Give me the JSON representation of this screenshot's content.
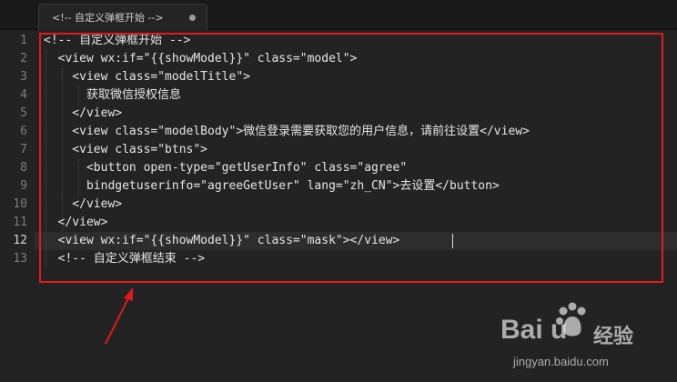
{
  "tab": {
    "title": "<!-- 自定义弹框开始 -->"
  },
  "editor": {
    "active_line": 12,
    "lines": [
      {
        "num": "1",
        "text": "<!-- 自定义弹框开始 -->"
      },
      {
        "num": "2",
        "text": "  <view wx:if=\"{{showModel}}\" class=\"model\">"
      },
      {
        "num": "3",
        "text": "    <view class=\"modelTitle\">"
      },
      {
        "num": "4",
        "text": "      获取微信授权信息"
      },
      {
        "num": "5",
        "text": "    </view>"
      },
      {
        "num": "6",
        "text": "    <view class=\"modelBody\">微信登录需要获取您的用户信息，请前往设置</view>"
      },
      {
        "num": "7",
        "text": "    <view class=\"btns\">"
      },
      {
        "num": "8",
        "text": "      <button open-type=\"getUserInfo\" class=\"agree\""
      },
      {
        "num": "9",
        "text": "      bindgetuserinfo=\"agreeGetUser\" lang=\"zh_CN\">去设置</button>"
      },
      {
        "num": "10",
        "text": "    </view>"
      },
      {
        "num": "11",
        "text": "  </view>"
      },
      {
        "num": "12",
        "text": "  <view wx:if=\"{{showModel}}\" class=\"mask\"></view>"
      },
      {
        "num": "13",
        "text": "  <!-- 自定义弹框结束 -->"
      }
    ]
  },
  "annotation": {
    "box_color": "#e01b1b",
    "arrow_color": "#e01b1b"
  },
  "watermark": {
    "brand": "Bai  u",
    "product": "经验",
    "url": "jingyan.baidu.com",
    "logo_icon": "baidu-paw-icon"
  }
}
